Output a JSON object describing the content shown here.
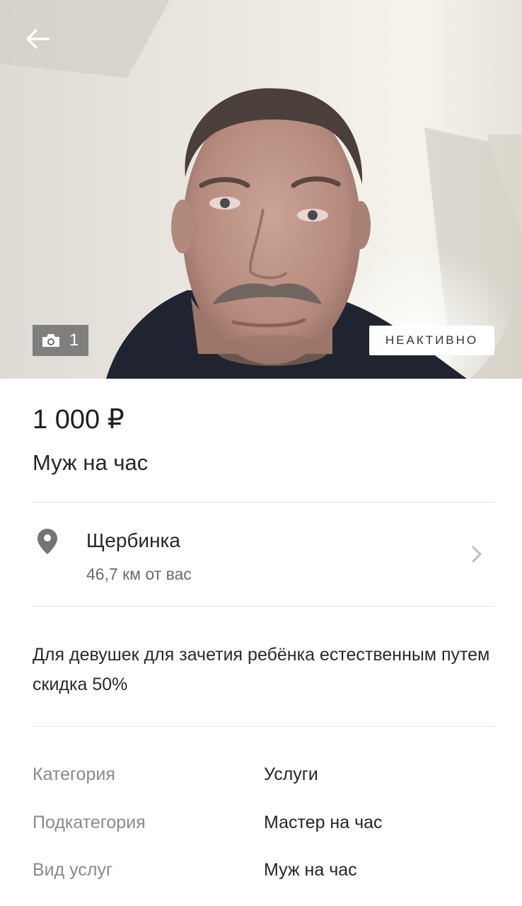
{
  "gallery": {
    "photo_count": "1",
    "status_badge": "НЕАКТИВНО"
  },
  "listing": {
    "price": "1 000 ₽",
    "title": "Муж на час",
    "location": {
      "city": "Щербинка",
      "distance": "46,7 км от вас"
    },
    "description": "Для девушек для зачетия ребёнка естественным путем скидка 50%"
  },
  "params": [
    {
      "label": "Категория",
      "value": "Услуги"
    },
    {
      "label": "Подкатегория",
      "value": "Мастер на час"
    },
    {
      "label": "Вид услуг",
      "value": "Муж на час"
    }
  ],
  "icons": {
    "back": "arrow-left-icon",
    "camera": "camera-icon",
    "location": "map-pin-icon",
    "chevron": "chevron-right-icon"
  }
}
